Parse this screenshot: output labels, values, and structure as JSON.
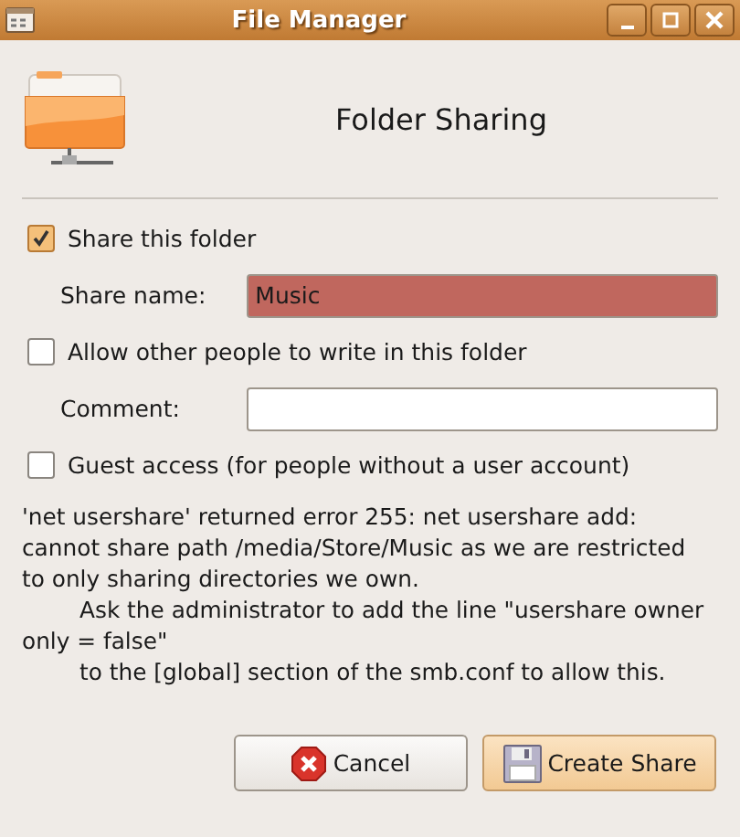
{
  "window": {
    "title": "File Manager"
  },
  "header": {
    "title": "Folder Sharing"
  },
  "checks": [
    {
      "kind": "check",
      "label": "Share this folder",
      "checked": true
    },
    {
      "kind": "field",
      "label": "Share name:",
      "value": "Music",
      "invalid": true
    },
    {
      "kind": "check",
      "label": "Allow other people to write in this folder",
      "checked": false
    },
    {
      "kind": "field",
      "label": "Comment:",
      "invalid": false
    },
    {
      "kind": "check",
      "label": "Guest access (for people without a user account)",
      "checked": false
    }
  ],
  "message": "'net usershare' returned error 255: net usershare add: cannot share path /media/Store/Music as we are restricted to only sharing directories we own.\n        Ask the administrator to add the line \"usershare owner only = false\"\n        to the [global] section of the smb.conf to allow this.",
  "buttons": [
    {
      "kind": "cancel",
      "label": "Cancel",
      "highlighted": false
    },
    {
      "kind": "save",
      "label": "Create Share",
      "highlighted": true
    }
  ]
}
